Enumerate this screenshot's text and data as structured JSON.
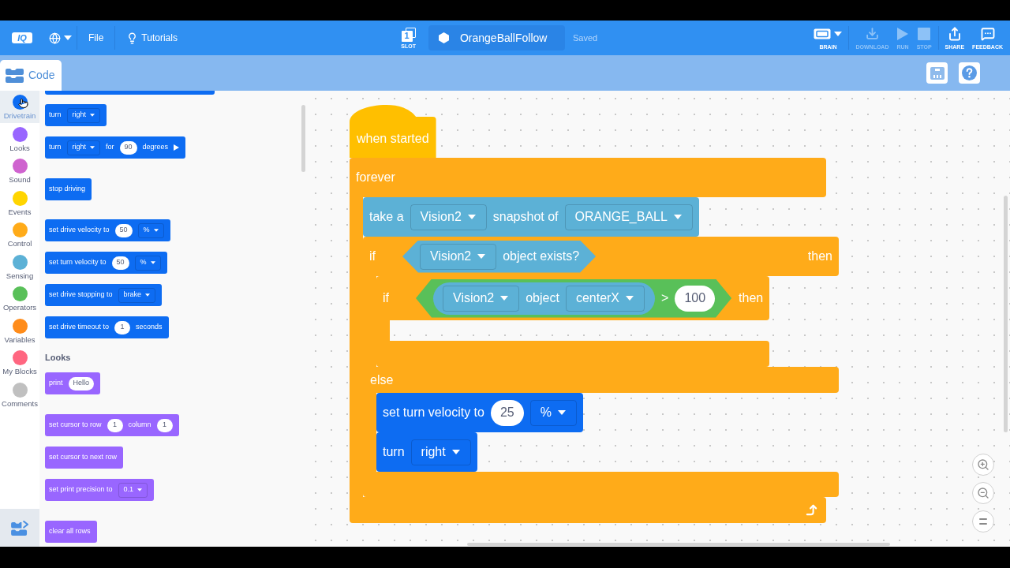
{
  "header": {
    "logo": "IQ",
    "menus": [
      {
        "label": "File",
        "kind": "file"
      },
      {
        "label": "Tutorials",
        "kind": "tutorials"
      }
    ]
  },
  "slot": {
    "number": "1",
    "label": "SLOT"
  },
  "project": {
    "name": "OrangeBallFollow",
    "status": "Saved"
  },
  "toolbar": [
    {
      "label": "BRAIN",
      "kind": "brain",
      "disabled": false
    },
    {
      "label": "DOWNLOAD",
      "kind": "download",
      "disabled": true
    },
    {
      "label": "RUN",
      "kind": "run",
      "disabled": true
    },
    {
      "label": "STOP",
      "kind": "stop",
      "disabled": true
    },
    {
      "label": "SHARE",
      "kind": "share",
      "disabled": false
    },
    {
      "label": "FEEDBACK",
      "kind": "feedback",
      "disabled": false
    }
  ],
  "tabs": [
    {
      "label": "Code",
      "selected": true
    }
  ],
  "categories": [
    {
      "label": "Drivetrain",
      "color": "#0d6cf2",
      "selected": true
    },
    {
      "label": "Looks",
      "color": "#9966ff",
      "selected": false
    },
    {
      "label": "Sound",
      "color": "#cf63cf",
      "selected": false
    },
    {
      "label": "Events",
      "color": "#ffd500",
      "selected": false
    },
    {
      "label": "Control",
      "color": "#ffab19",
      "selected": false
    },
    {
      "label": "Sensing",
      "color": "#5cb1d6",
      "selected": false
    },
    {
      "label": "Operators",
      "color": "#59c059",
      "selected": false
    },
    {
      "label": "Variables",
      "color": "#ff8c1a",
      "selected": false
    },
    {
      "label": "My Blocks",
      "color": "#ff6680",
      "selected": false
    },
    {
      "label": "Comments",
      "color": "#c0c0c0",
      "selected": false
    }
  ],
  "palette": {
    "sections": [
      {
        "color": "#0d6cf2",
        "blocks": [
          {
            "kind": "cut_off"
          },
          {
            "kind": "stack",
            "parts": [
              {
                "kind": "text",
                "text": "turn"
              },
              {
                "kind": "dropdown",
                "text": "right"
              }
            ]
          },
          {
            "kind": "stack",
            "parts": [
              {
                "kind": "text",
                "text": "turn"
              },
              {
                "kind": "dropdown",
                "text": "right"
              },
              {
                "kind": "text",
                "text": "for"
              },
              {
                "kind": "input",
                "text": "90"
              },
              {
                "kind": "text",
                "text": "degrees"
              },
              {
                "kind": "expander"
              }
            ]
          },
          {
            "kind": "stack",
            "parts": [
              {
                "kind": "text",
                "text": "stop driving"
              }
            ]
          },
          {
            "kind": "stack",
            "parts": [
              {
                "kind": "text",
                "text": "set drive velocity to"
              },
              {
                "kind": "input",
                "text": "50"
              },
              {
                "kind": "dropdown",
                "text": "%"
              }
            ]
          },
          {
            "kind": "stack",
            "parts": [
              {
                "kind": "text",
                "text": "set turn velocity to"
              },
              {
                "kind": "input",
                "text": "50"
              },
              {
                "kind": "dropdown",
                "text": "%"
              }
            ]
          },
          {
            "kind": "stack",
            "parts": [
              {
                "kind": "text",
                "text": "set drive stopping to"
              },
              {
                "kind": "dropdown",
                "text": "brake"
              }
            ]
          },
          {
            "kind": "stack",
            "parts": [
              {
                "kind": "text",
                "text": "set drive timeout to"
              },
              {
                "kind": "input",
                "text": "1"
              },
              {
                "kind": "text",
                "text": "seconds"
              }
            ]
          }
        ]
      },
      {
        "heading": "Looks",
        "color": "#9966ff",
        "blocks": [
          {
            "kind": "stack",
            "parts": [
              {
                "kind": "text",
                "text": "print"
              },
              {
                "kind": "input",
                "text": "Hello"
              }
            ]
          },
          {
            "kind": "stack",
            "parts": [
              {
                "kind": "text",
                "text": "set cursor to row"
              },
              {
                "kind": "input",
                "text": "1"
              },
              {
                "kind": "text",
                "text": "column"
              },
              {
                "kind": "input",
                "text": "1"
              }
            ]
          },
          {
            "kind": "stack",
            "parts": [
              {
                "kind": "text",
                "text": "set cursor to next row"
              }
            ]
          },
          {
            "kind": "stack",
            "parts": [
              {
                "kind": "text",
                "text": "set print precision to"
              },
              {
                "kind": "dropdown",
                "text": "0.1"
              }
            ]
          },
          {
            "kind": "stack",
            "parts": [
              {
                "kind": "text",
                "text": "clear all rows"
              }
            ]
          }
        ]
      }
    ]
  },
  "script": [
    {
      "kind": "hat",
      "color": "#ffbf00",
      "parts": [
        {
          "kind": "text",
          "text": "when started"
        }
      ]
    },
    {
      "kind": "forever",
      "color": "#ffab19",
      "parts": [
        {
          "kind": "text",
          "text": "forever"
        }
      ],
      "body": [
        {
          "kind": "stack",
          "color": "#5cb1d6",
          "parts": [
            {
              "kind": "text",
              "text": "take a"
            },
            {
              "kind": "dropdown",
              "text": "Vision2"
            },
            {
              "kind": "text",
              "text": "snapshot of"
            },
            {
              "kind": "dropdown",
              "text": "ORANGE_BALL"
            }
          ]
        },
        {
          "kind": "if_else",
          "color": "#ffab19",
          "parts": [
            {
              "kind": "text",
              "text": "if"
            },
            {
              "kind": "boolean",
              "color": "#5cb1d6",
              "parts": [
                {
                  "kind": "dropdown",
                  "text": "Vision2"
                },
                {
                  "kind": "text",
                  "text": "object exists?"
                }
              ]
            },
            {
              "kind": "end",
              "text": "then"
            }
          ],
          "body": [
            {
              "kind": "if",
              "color": "#ffab19",
              "parts": [
                {
                  "kind": "text",
                  "text": "if"
                },
                {
                  "kind": "boolean",
                  "color": "#59c059",
                  "parts": [
                    {
                      "kind": "reporter",
                      "color": "#5cb1d6",
                      "parts": [
                        {
                          "kind": "dropdown",
                          "text": "Vision2"
                        },
                        {
                          "kind": "text",
                          "text": "object"
                        },
                        {
                          "kind": "dropdown",
                          "text": "centerX"
                        }
                      ]
                    },
                    {
                      "kind": "text",
                      "text": ">"
                    },
                    {
                      "kind": "input",
                      "text": "100"
                    }
                  ]
                },
                {
                  "kind": "end",
                  "text": "then"
                }
              ]
            }
          ],
          "else_label": "else",
          "else_body": [
            {
              "kind": "stack",
              "color": "#0d6cf2",
              "parts": [
                {
                  "kind": "text",
                  "text": "set turn velocity to"
                },
                {
                  "kind": "input",
                  "text": "25"
                },
                {
                  "kind": "dropdown",
                  "text": "%"
                }
              ]
            },
            {
              "kind": "stack",
              "color": "#0d6cf2",
              "parts": [
                {
                  "kind": "text",
                  "text": "turn"
                },
                {
                  "kind": "dropdown",
                  "text": "right"
                }
              ]
            }
          ]
        }
      ]
    }
  ]
}
